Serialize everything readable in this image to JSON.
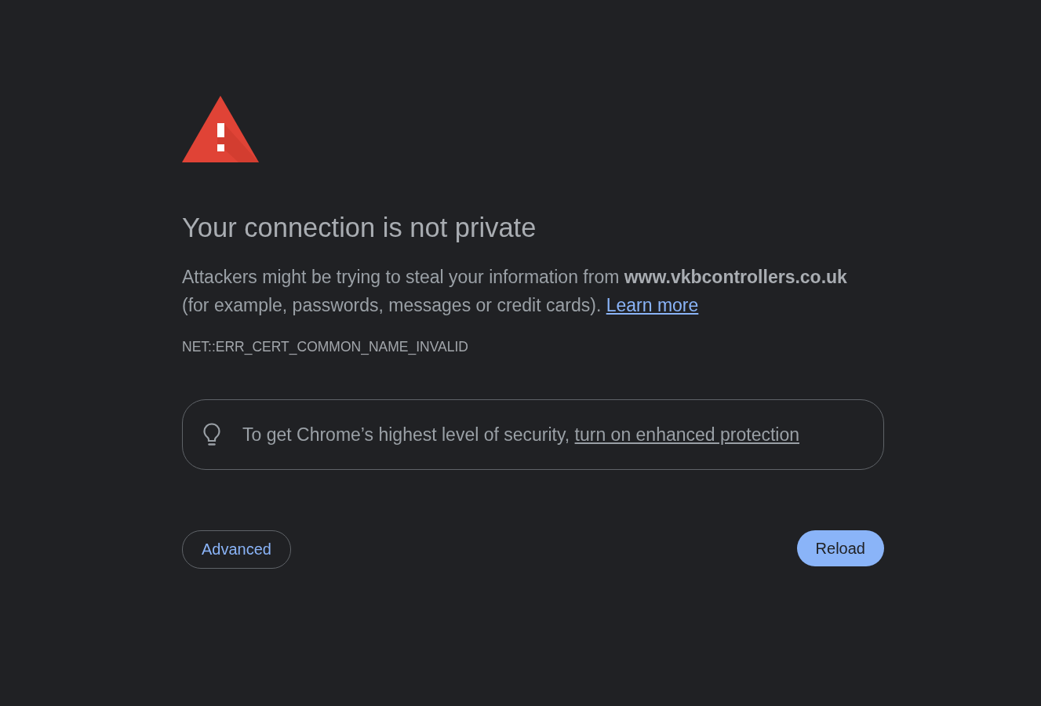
{
  "heading": "Your connection is not private",
  "explanation": {
    "text": "Attackers might be trying to steal your information from **www.vkbcontrollers.co.uk** (for example, passwords, messages or credit cards).",
    "link": "Learn more"
  },
  "error_code": "NET::ERR_CERT_COMMON_NAME_INVALID",
  "promo": {
    "text": "To get Chrome’s highest level of security,",
    "link": "turn on enhanced protection"
  },
  "buttons": [
    {
      "label": "Advanced",
      "kind": "secondary"
    },
    {
      "label": "Reload",
      "kind": "primary"
    }
  ]
}
